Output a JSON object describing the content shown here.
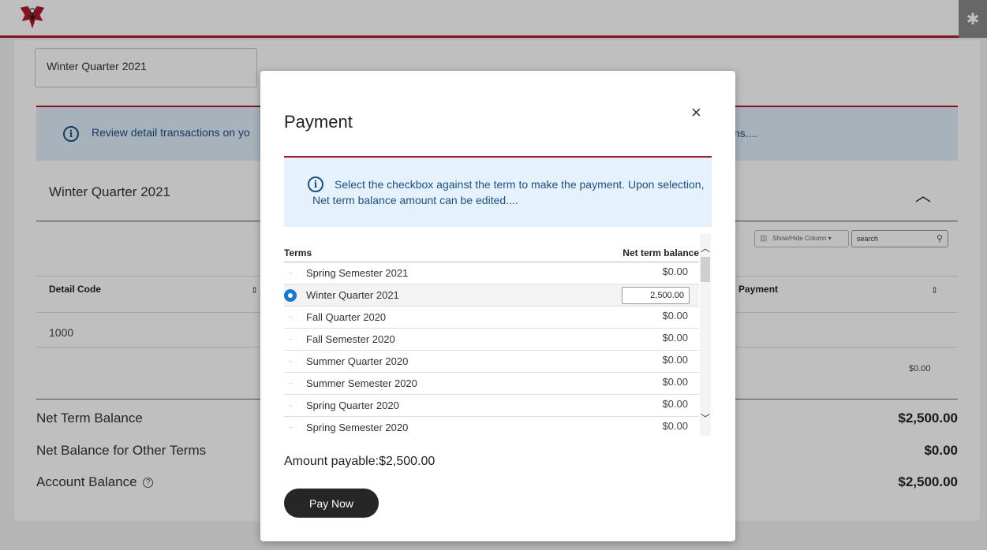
{
  "header": {
    "logo_icon": "eagle-logo-icon",
    "settings_icon": "gear-icon"
  },
  "background": {
    "term_selector": "Winter Quarter 2021",
    "banner": {
      "text": "Review detail transactions on yo",
      "text_tail": "ns...."
    },
    "section_title": "Winter Quarter 2021",
    "toolbar": {
      "show_hide_label": "Show/Hide Column ▾",
      "search_value": "search"
    },
    "columns": {
      "detail_code": "Detail Code",
      "payment": "Payment"
    },
    "rows": [
      {
        "detail_code": "1000"
      }
    ],
    "payment_total": "$0.00",
    "summary": [
      {
        "label": "Net Term Balance",
        "value": "$2,500.00"
      },
      {
        "label": "Net Balance for Other Terms",
        "value": "$0.00"
      },
      {
        "label": "Account Balance",
        "value": "$2,500.00"
      }
    ]
  },
  "modal": {
    "title": "Payment",
    "close_label": "×",
    "info": "Select the checkbox against the term to make the payment. Upon selection, Net term balance amount can be edited....",
    "columns": {
      "terms": "Terms",
      "net_term_balance": "Net term balance"
    },
    "terms": [
      {
        "name": "Spring Semester 2021",
        "balance": "$0.00",
        "selected": false
      },
      {
        "name": "Winter Quarter 2021",
        "balance": "2,500.00",
        "selected": true
      },
      {
        "name": "Fall Quarter 2020",
        "balance": "$0.00",
        "selected": false
      },
      {
        "name": "Fall Semester 2020",
        "balance": "$0.00",
        "selected": false
      },
      {
        "name": "Summer Quarter 2020",
        "balance": "$0.00",
        "selected": false
      },
      {
        "name": "Summer Semester 2020",
        "balance": "$0.00",
        "selected": false
      },
      {
        "name": "Spring Quarter 2020",
        "balance": "$0.00",
        "selected": false
      },
      {
        "name": "Spring Semester 2020",
        "balance": "$0.00",
        "selected": false
      }
    ],
    "amount_payable": "Amount payable:$2,500.00",
    "pay_button": "Pay Now"
  },
  "colors": {
    "accent_red": "#b0182b",
    "info_blue": "#1a4f8a",
    "radio_blue": "#1877d2"
  }
}
